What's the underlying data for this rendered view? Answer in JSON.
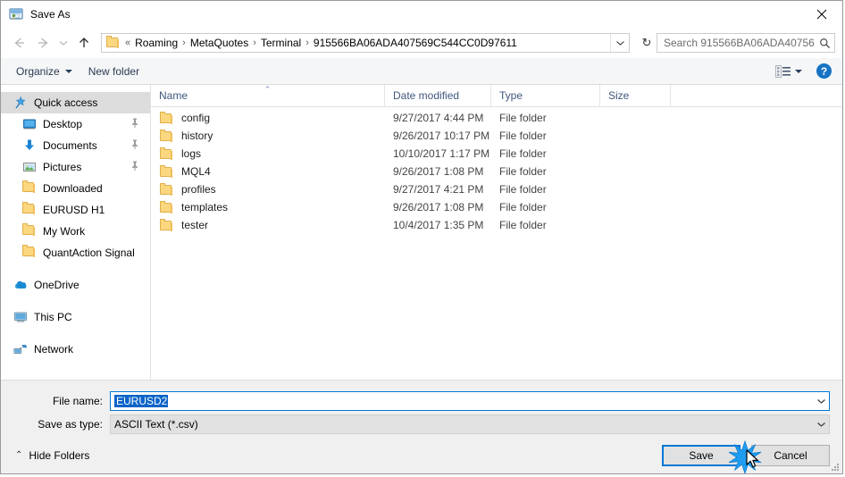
{
  "window": {
    "title": "Save As",
    "icon": "save-as-icon",
    "close_label": "✕"
  },
  "nav": {
    "back_icon": "←",
    "forward_icon": "→",
    "recent_icon": "⌄",
    "up_icon": "↑",
    "breadcrumb_prefix": "«",
    "breadcrumbs": [
      "Roaming",
      "MetaQuotes",
      "Terminal",
      "915566BA06ADA407569C544CC0D97611"
    ],
    "separator": "›",
    "dropdown_icon": "⌄",
    "refresh_icon": "↻"
  },
  "search": {
    "placeholder": "Search 915566BA06ADA40756...",
    "icon": "search-icon"
  },
  "toolbar": {
    "organize_label": "Organize",
    "new_folder_label": "New folder",
    "view_icon": "list-view-icon",
    "help_label": "?"
  },
  "sidebar": {
    "items": [
      {
        "label": "Quick access",
        "icon": "star-pin-icon",
        "selected": true,
        "indent": "root",
        "pinned": false
      },
      {
        "label": "Desktop",
        "icon": "desktop-icon",
        "selected": false,
        "indent": "child",
        "pinned": true
      },
      {
        "label": "Documents",
        "icon": "documents-icon",
        "selected": false,
        "indent": "child",
        "pinned": true
      },
      {
        "label": "Pictures",
        "icon": "pictures-icon",
        "selected": false,
        "indent": "child",
        "pinned": true
      },
      {
        "label": "Downloaded",
        "icon": "folder-icon",
        "selected": false,
        "indent": "child",
        "pinned": false
      },
      {
        "label": "EURUSD H1",
        "icon": "folder-icon",
        "selected": false,
        "indent": "child",
        "pinned": false
      },
      {
        "label": "My Work",
        "icon": "folder-icon",
        "selected": false,
        "indent": "child",
        "pinned": false
      },
      {
        "label": "QuantAction Signal",
        "icon": "folder-icon",
        "selected": false,
        "indent": "child",
        "pinned": false
      },
      {
        "label": "OneDrive",
        "icon": "onedrive-icon",
        "selected": false,
        "indent": "root",
        "pinned": false,
        "gap_before": true
      },
      {
        "label": "This PC",
        "icon": "this-pc-icon",
        "selected": false,
        "indent": "root",
        "pinned": false,
        "gap_before": true
      },
      {
        "label": "Network",
        "icon": "network-icon",
        "selected": false,
        "indent": "root",
        "pinned": false,
        "gap_before": true
      }
    ],
    "pin_glyph": "📌"
  },
  "filelist": {
    "columns": [
      "Name",
      "Date modified",
      "Type",
      "Size"
    ],
    "sort_caret": "⌃",
    "rows": [
      {
        "name": "config",
        "date": "9/27/2017 4:44 PM",
        "type": "File folder",
        "size": ""
      },
      {
        "name": "history",
        "date": "9/26/2017 10:17 PM",
        "type": "File folder",
        "size": ""
      },
      {
        "name": "logs",
        "date": "10/10/2017 1:17 PM",
        "type": "File folder",
        "size": ""
      },
      {
        "name": "MQL4",
        "date": "9/26/2017 1:08 PM",
        "type": "File folder",
        "size": ""
      },
      {
        "name": "profiles",
        "date": "9/27/2017 4:21 PM",
        "type": "File folder",
        "size": ""
      },
      {
        "name": "templates",
        "date": "9/26/2017 1:08 PM",
        "type": "File folder",
        "size": ""
      },
      {
        "name": "tester",
        "date": "10/4/2017 1:35 PM",
        "type": "File folder",
        "size": ""
      }
    ]
  },
  "form": {
    "filename_label": "File name:",
    "filename_value": "EURUSD2",
    "filetype_label": "Save as type:",
    "filetype_value": "ASCII Text (*.csv)",
    "dropdown_icon": "⌄"
  },
  "footer": {
    "hide_folders_label": "Hide Folders",
    "hide_folders_icon": "⌃",
    "save_label": "Save",
    "cancel_label": "Cancel"
  },
  "colors": {
    "accent": "#0078d7",
    "selection": "#0a64c8",
    "folder": "#fbd77f",
    "header_text": "#41567a",
    "help_blue": "#1673c4"
  }
}
